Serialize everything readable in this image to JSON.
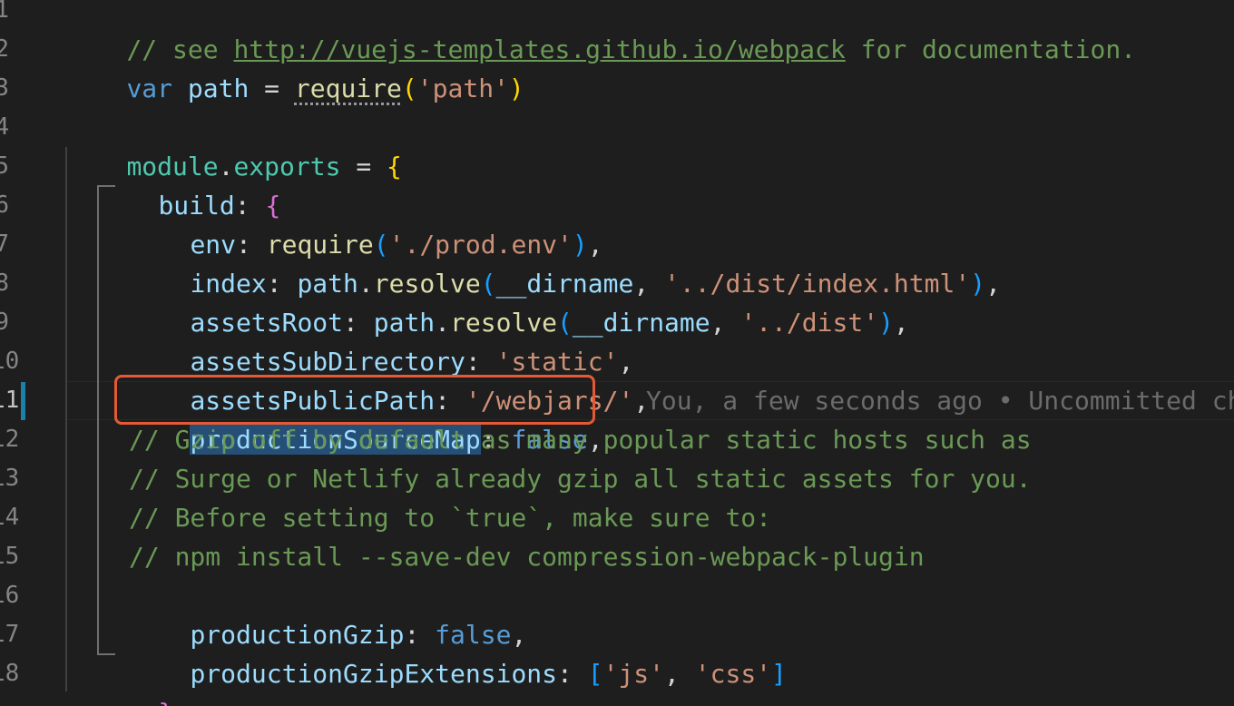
{
  "editor": {
    "line_numbers": [
      "1",
      "2",
      "3",
      "4",
      "5",
      "6",
      "7",
      "8",
      "9",
      "10",
      "11",
      "12",
      "13",
      "14",
      "15",
      "16",
      "17",
      "18"
    ],
    "lines": {
      "l1": {
        "comment_prefix": "// see ",
        "link": "http://vuejs-templates.github.io/webpack",
        "comment_suffix": " for documentation."
      },
      "l2": {
        "kw": "var",
        "name": " path",
        "eq": " = ",
        "fn": "require",
        "open": "(",
        "str": "'path'",
        "close": ")"
      },
      "l4": {
        "obj": "module",
        "dot": ".",
        "prop": "exports",
        "eq": " = ",
        "brace": "{"
      },
      "l5": {
        "key": "build",
        "colon": ": ",
        "brace": "{"
      },
      "l6": {
        "key": "env",
        "colon": ": ",
        "fn": "require",
        "open": "(",
        "str": "'./prod.env'",
        "close": ")",
        "comma": ","
      },
      "l7": {
        "key": "index",
        "colon": ": ",
        "obj": "path",
        "dot": ".",
        "fn": "resolve",
        "open": "(",
        "arg": "__dirname",
        "sep": ", ",
        "str": "'../dist/index.html'",
        "close": ")",
        "comma": ","
      },
      "l8": {
        "key": "assetsRoot",
        "colon": ": ",
        "obj": "path",
        "dot": ".",
        "fn": "resolve",
        "open": "(",
        "arg": "__dirname",
        "sep": ", ",
        "str": "'../dist'",
        "close": ")",
        "comma": ","
      },
      "l9": {
        "key": "assetsSubDirectory",
        "colon": ": ",
        "str": "'static'",
        "comma": ","
      },
      "l10": {
        "key": "assetsPublicPath",
        "colon": ": ",
        "str": "'/webjars/'",
        "comma": ","
      },
      "l11": {
        "key": "productionSourceMap",
        "colon": ": ",
        "value": "false",
        "comma": ","
      },
      "l12": {
        "comment": "// Gzip off by default as many popular static hosts such as"
      },
      "l13": {
        "comment": "// Surge or Netlify already gzip all static assets for you."
      },
      "l14": {
        "comment": "// Before setting to `true`, make sure to:"
      },
      "l15": {
        "comment": "// npm install --save-dev compression-webpack-plugin"
      },
      "l16": {
        "key": "productionGzip",
        "colon": ": ",
        "value": "false",
        "comma": ","
      },
      "l17": {
        "key": "productionGzipExtensions",
        "colon": ": ",
        "open": "[",
        "s1": "'js'",
        "sep": ", ",
        "s2": "'css'",
        "close": "]"
      },
      "l18": {
        "brace": "}",
        "comma": ","
      }
    },
    "blame": "You, a few seconds ago • Uncommitted changes"
  },
  "colors": {
    "background": "#1e1e1e",
    "highlight_box": "#e55a34",
    "git_modified": "#1b81a8"
  }
}
